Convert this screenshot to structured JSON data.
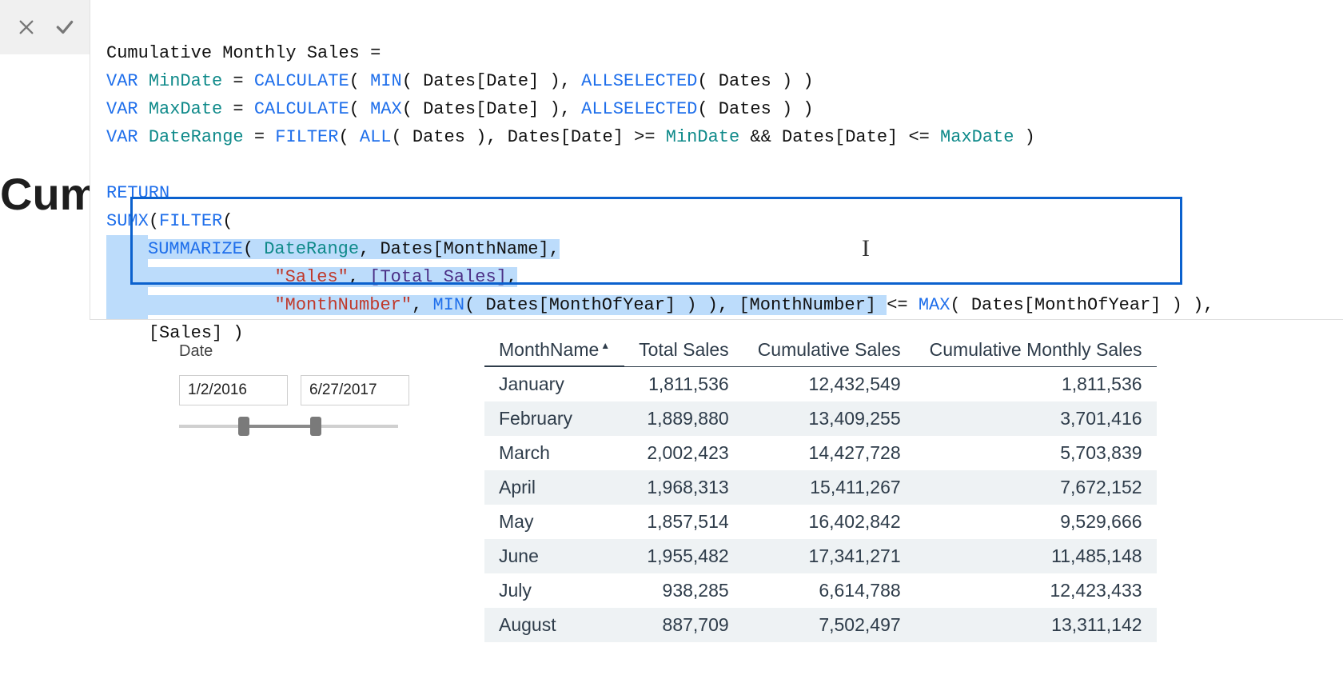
{
  "title_fragment": "Cum",
  "formula": {
    "measure_name": "Cumulative Monthly Sales",
    "line1_pre": "Cumulative Monthly Sales ",
    "eq": "=",
    "var_kw": "VAR",
    "min_var": "MinDate",
    "max_var": "MaxDate",
    "range_var": "DateRange",
    "calc": "CALCULATE",
    "min": "MIN",
    "max": "MAX",
    "allsel": "ALLSELECTED",
    "filter": "FILTER",
    "all": "ALL",
    "return": "RETURN",
    "sumx": "SUMX",
    "summarize": "SUMMARIZE",
    "dates_col": "Dates[Date]",
    "dates_tbl": "Dates",
    "monthname": "Dates[MonthName]",
    "sales_str": "\"Sales\"",
    "total_sales": "[Total Sales]",
    "monthnum_str": "\"MonthNumber\"",
    "monthofyear": "Dates[MonthOfYear]",
    "monthnumber": "[MonthNumber]",
    "sales_ref": "[Sales]",
    "ge": ">=",
    "le": "<=",
    "amp": "&&"
  },
  "slicer": {
    "label": "Date",
    "from": "1/2/2016",
    "to": "6/27/2017"
  },
  "table": {
    "headers": [
      "MonthName",
      "Total Sales",
      "Cumulative Sales",
      "Cumulative Monthly Sales"
    ],
    "rows": [
      [
        "January",
        "1,811,536",
        "12,432,549",
        "1,811,536"
      ],
      [
        "February",
        "1,889,880",
        "13,409,255",
        "3,701,416"
      ],
      [
        "March",
        "2,002,423",
        "14,427,728",
        "5,703,839"
      ],
      [
        "April",
        "1,968,313",
        "15,411,267",
        "7,672,152"
      ],
      [
        "May",
        "1,857,514",
        "16,402,842",
        "9,529,666"
      ],
      [
        "June",
        "1,955,482",
        "17,341,271",
        "11,485,148"
      ],
      [
        "July",
        "938,285",
        "6,614,788",
        "12,423,433"
      ],
      [
        "August",
        "887,709",
        "7,502,497",
        "13,311,142"
      ]
    ]
  },
  "chart_data": {
    "type": "table",
    "title": "Cumulative Monthly Sales",
    "columns": [
      "MonthName",
      "Total Sales",
      "Cumulative Sales",
      "Cumulative Monthly Sales"
    ],
    "rows": [
      {
        "MonthName": "January",
        "Total Sales": 1811536,
        "Cumulative Sales": 12432549,
        "Cumulative Monthly Sales": 1811536
      },
      {
        "MonthName": "February",
        "Total Sales": 1889880,
        "Cumulative Sales": 13409255,
        "Cumulative Monthly Sales": 3701416
      },
      {
        "MonthName": "March",
        "Total Sales": 2002423,
        "Cumulative Sales": 14427728,
        "Cumulative Monthly Sales": 5703839
      },
      {
        "MonthName": "April",
        "Total Sales": 1968313,
        "Cumulative Sales": 15411267,
        "Cumulative Monthly Sales": 7672152
      },
      {
        "MonthName": "May",
        "Total Sales": 1857514,
        "Cumulative Sales": 16402842,
        "Cumulative Monthly Sales": 9529666
      },
      {
        "MonthName": "June",
        "Total Sales": 1955482,
        "Cumulative Sales": 17341271,
        "Cumulative Monthly Sales": 11485148
      },
      {
        "MonthName": "July",
        "Total Sales": 938285,
        "Cumulative Sales": 6614788,
        "Cumulative Monthly Sales": 12423433
      },
      {
        "MonthName": "August",
        "Total Sales": 887709,
        "Cumulative Sales": 7502497,
        "Cumulative Monthly Sales": 13311142
      }
    ]
  }
}
